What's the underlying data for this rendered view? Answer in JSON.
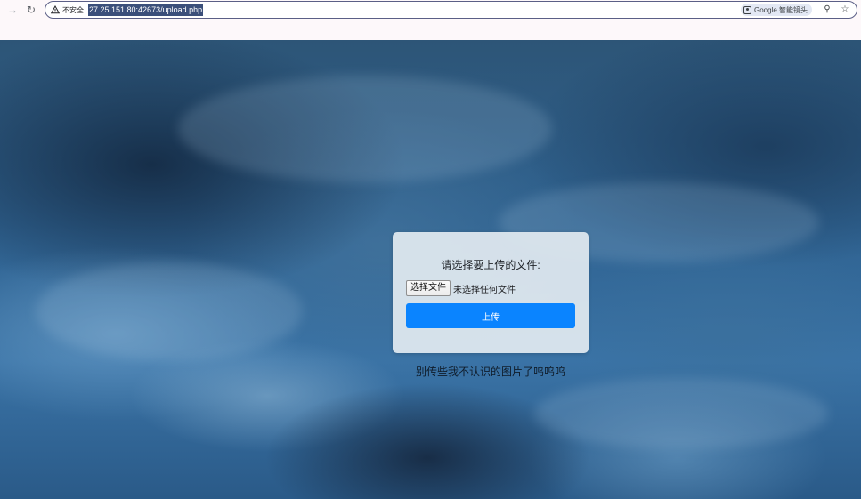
{
  "browser": {
    "security_label": "不安全",
    "url": "27.25.151.80:42673/upload.php",
    "lens_label": "Google 智能镜头",
    "icons": {
      "forward": "arrow-right-icon",
      "reload": "reload-icon",
      "security": "warning-triangle-icon",
      "lens": "google-lens-icon",
      "zoom": "zoom-icon",
      "bookmark": "star-icon"
    }
  },
  "page": {
    "card": {
      "title": "请选择要上传的文件:",
      "choose_file_label": "选择文件",
      "file_status": "未选择任何文件",
      "upload_label": "上传"
    },
    "tagline": "别传些我不认识的图片了呜呜呜",
    "colors": {
      "upload_button": "#0a84ff",
      "card_background": "#e1e9f0"
    }
  }
}
